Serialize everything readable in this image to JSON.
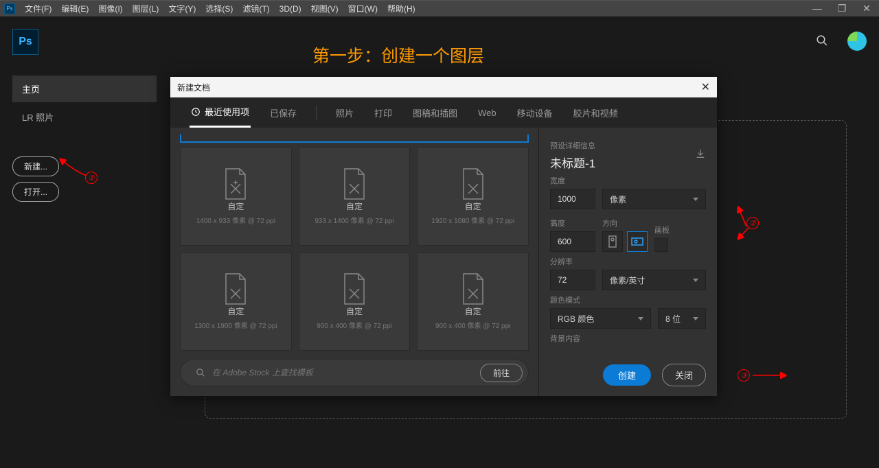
{
  "menu": {
    "items": [
      "文件(F)",
      "编辑(E)",
      "图像(I)",
      "图层(L)",
      "文字(Y)",
      "选择(S)",
      "滤镜(T)",
      "3D(D)",
      "视图(V)",
      "窗口(W)",
      "帮助(H)"
    ]
  },
  "orange_hint": "第一步：创建一个图层",
  "sidebar": {
    "home": "主页",
    "lr": "LR 照片",
    "new_btn": "新建...",
    "open_btn": "打开..."
  },
  "modal": {
    "title": "新建文档",
    "tabs": [
      "最近使用项",
      "已保存",
      "照片",
      "打印",
      "图稿和插图",
      "Web",
      "移动设备",
      "胶片和视频"
    ],
    "presets": [
      {
        "name": "自定",
        "dims": "1400 x 933 像素 @ 72 ppi"
      },
      {
        "name": "自定",
        "dims": "933 x 1400 像素 @ 72 ppi"
      },
      {
        "name": "自定",
        "dims": "1920 x 1080 像素 @ 72 ppi"
      },
      {
        "name": "自定",
        "dims": "1300 x 1900 像素 @ 72 ppi"
      },
      {
        "name": "自定",
        "dims": "900 x 400 像素 @ 72 ppi"
      },
      {
        "name": "自定",
        "dims": "900 x 400 像素 @ 72 ppi"
      }
    ],
    "stock_placeholder": "在 Adobe Stock 上查找模板",
    "stock_go": "前往",
    "detail": {
      "section": "预设详细信息",
      "doc_title": "未标题-1",
      "width_label": "宽度",
      "width": "1000",
      "width_unit": "像素",
      "height_label": "高度",
      "height": "600",
      "orient_label": "方向",
      "artboard_label": "画板",
      "res_label": "分辨率",
      "res": "72",
      "res_unit": "像素/英寸",
      "color_label": "颜色模式",
      "color": "RGB 颜色",
      "bits": "8 位",
      "bg_label": "背景内容"
    },
    "create": "创建",
    "close": "关闭"
  },
  "anno": {
    "n1": "①",
    "n2": "②",
    "n3": "③"
  }
}
